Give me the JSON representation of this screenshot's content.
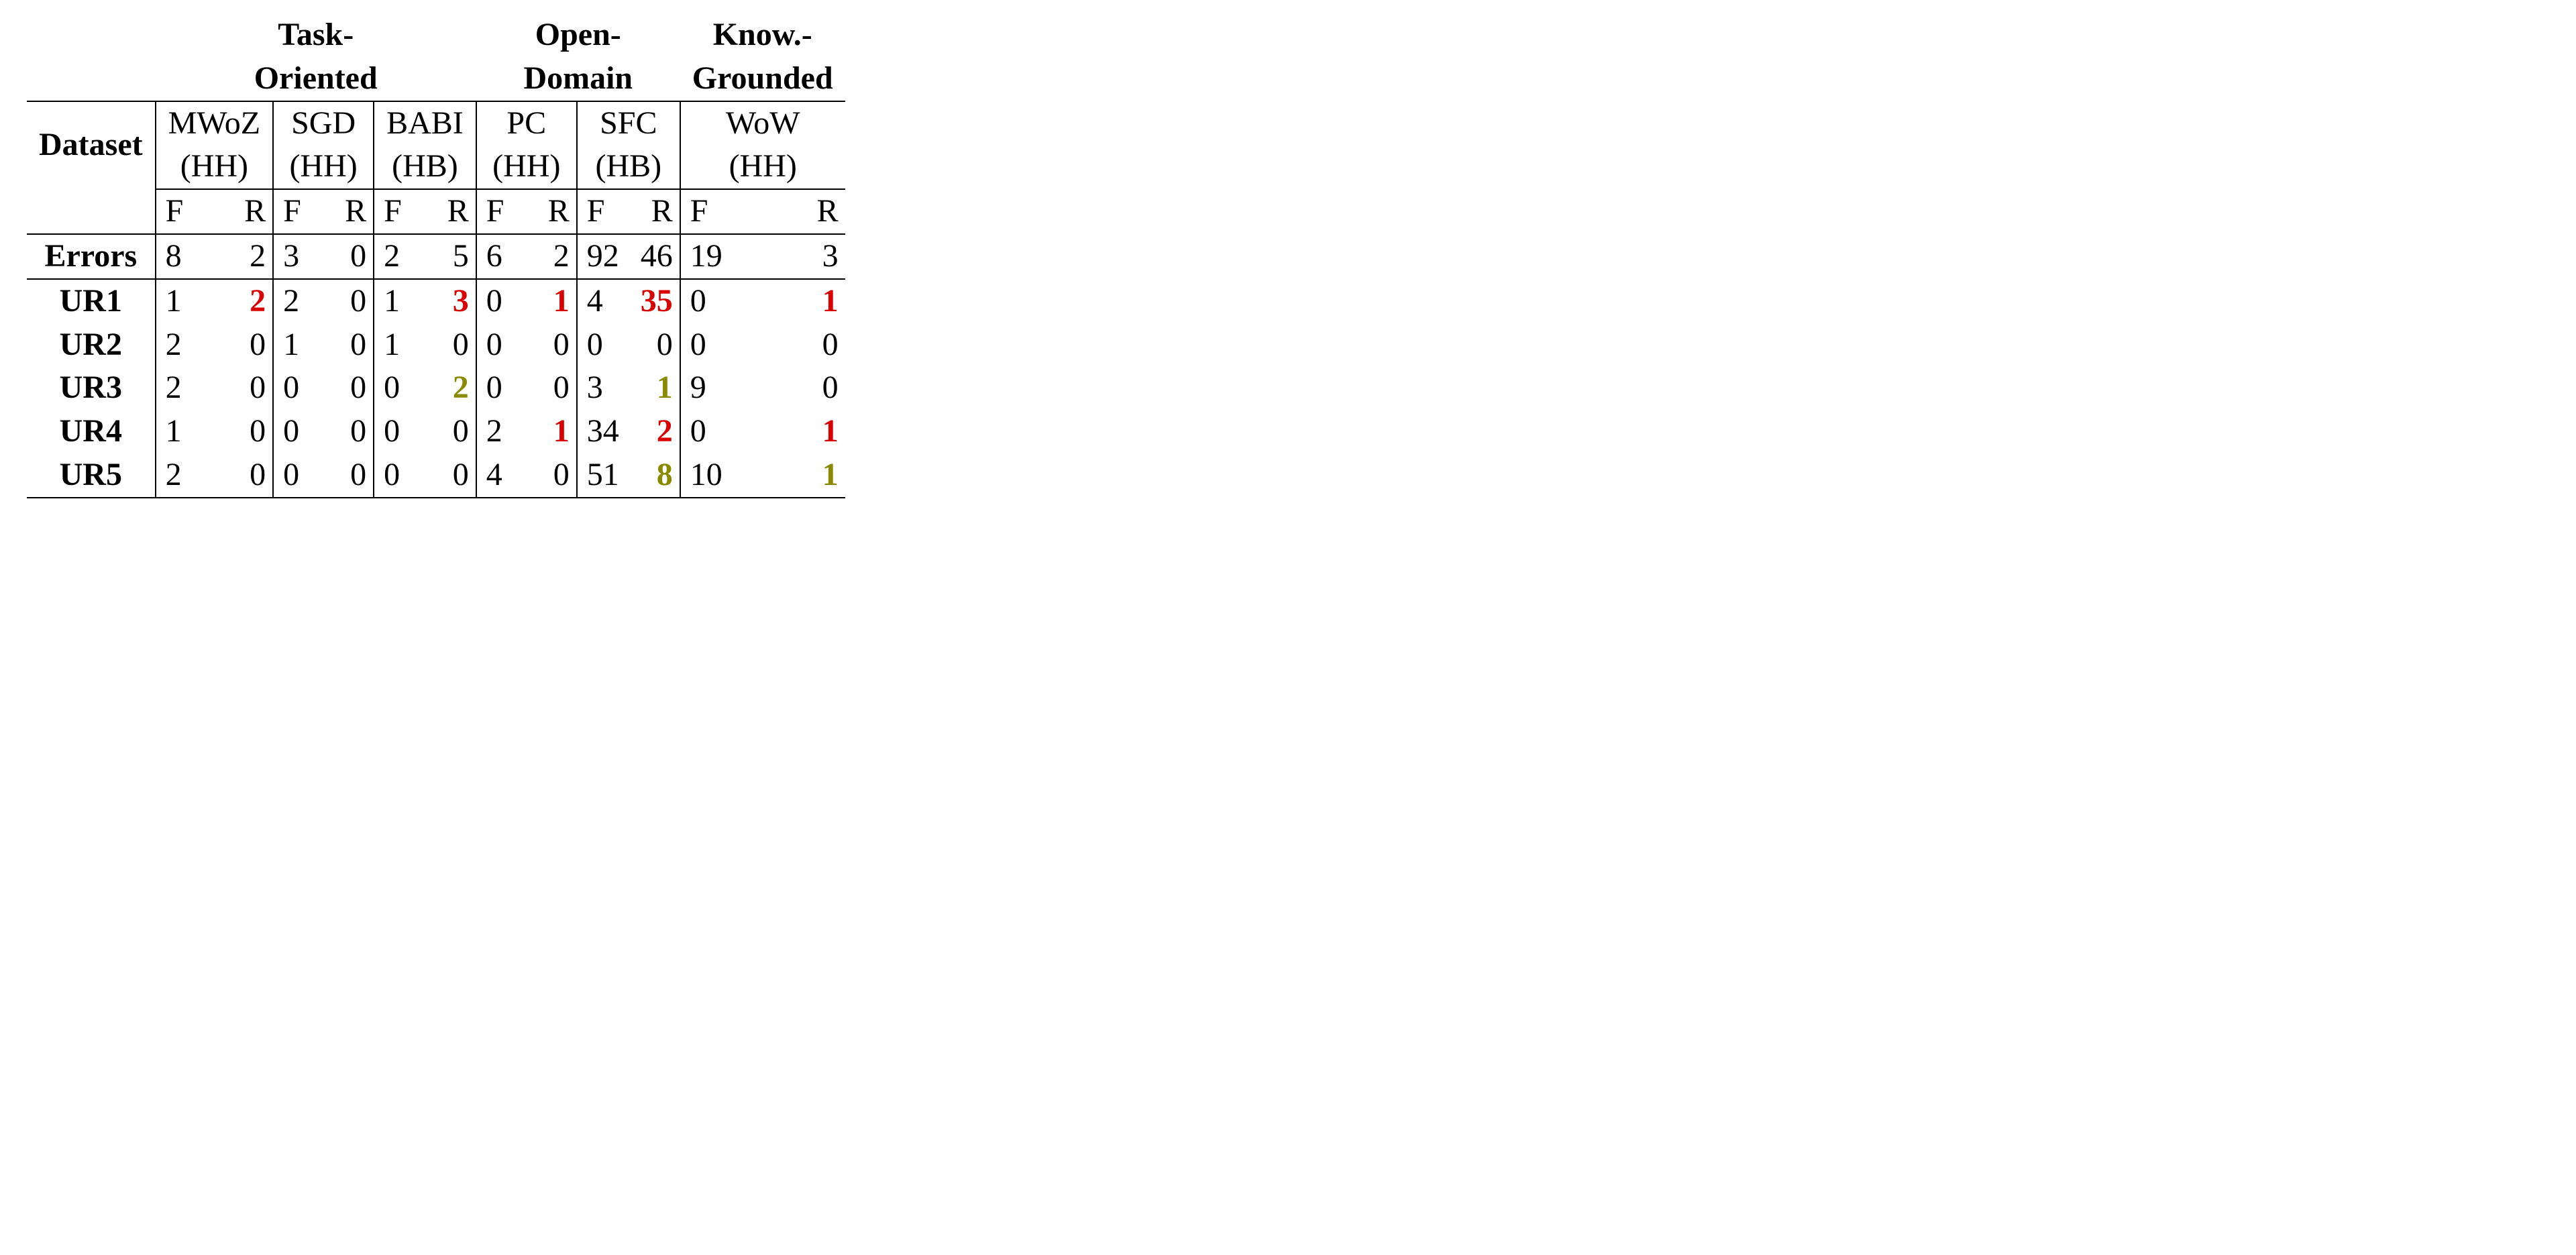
{
  "chart_data": {
    "type": "table",
    "groups": [
      {
        "name": "Task-Oriented",
        "datasets": [
          "MWoZ (HH)",
          "SGD (HH)",
          "BABI (HB)"
        ]
      },
      {
        "name": "Open-Domain",
        "datasets": [
          "PC (HH)",
          "SFC (HB)"
        ]
      },
      {
        "name": "Know.-Grounded",
        "datasets": [
          "WoW (HH)"
        ]
      }
    ],
    "subcolumns": [
      "F",
      "R"
    ],
    "rows": [
      {
        "label": "Errors",
        "values": [
          [
            8,
            2
          ],
          [
            3,
            0
          ],
          [
            2,
            5
          ],
          [
            6,
            2
          ],
          [
            92,
            46
          ],
          [
            19,
            3
          ]
        ]
      },
      {
        "label": "UR1",
        "values": [
          [
            1,
            2
          ],
          [
            2,
            0
          ],
          [
            1,
            3
          ],
          [
            0,
            1
          ],
          [
            4,
            35
          ],
          [
            0,
            1
          ]
        ]
      },
      {
        "label": "UR2",
        "values": [
          [
            2,
            0
          ],
          [
            1,
            0
          ],
          [
            1,
            0
          ],
          [
            0,
            0
          ],
          [
            0,
            0
          ],
          [
            0,
            0
          ]
        ]
      },
      {
        "label": "UR3",
        "values": [
          [
            2,
            0
          ],
          [
            0,
            0
          ],
          [
            0,
            2
          ],
          [
            0,
            0
          ],
          [
            3,
            1
          ],
          [
            9,
            0
          ]
        ]
      },
      {
        "label": "UR4",
        "values": [
          [
            1,
            0
          ],
          [
            0,
            0
          ],
          [
            0,
            0
          ],
          [
            2,
            1
          ],
          [
            34,
            2
          ],
          [
            0,
            1
          ]
        ]
      },
      {
        "label": "UR5",
        "values": [
          [
            2,
            0
          ],
          [
            0,
            0
          ],
          [
            0,
            0
          ],
          [
            4,
            0
          ],
          [
            51,
            8
          ],
          [
            10,
            1
          ]
        ]
      }
    ],
    "highlight": {
      "red": [
        [
          "UR1",
          0,
          "R"
        ],
        [
          "UR1",
          2,
          "R"
        ],
        [
          "UR1",
          3,
          "R"
        ],
        [
          "UR1",
          4,
          "R"
        ],
        [
          "UR1",
          5,
          "R"
        ],
        [
          "UR4",
          3,
          "R"
        ],
        [
          "UR4",
          4,
          "R"
        ],
        [
          "UR4",
          5,
          "R"
        ]
      ],
      "olive": [
        [
          "UR3",
          2,
          "R"
        ],
        [
          "UR3",
          4,
          "R"
        ],
        [
          "UR5",
          4,
          "R"
        ],
        [
          "UR5",
          5,
          "R"
        ]
      ]
    }
  },
  "hdr": {
    "grp0a": "Task-",
    "grp0b": "Oriented",
    "grp1a": "Open-",
    "grp1b": "Domain",
    "grp2a": "Know.-",
    "grp2b": "Grounded",
    "dataset": "Dataset",
    "d0a": "MWoZ",
    "d0b": "(HH)",
    "d1a": "SGD",
    "d1b": "(HH)",
    "d2a": "BABI",
    "d2b": "(HB)",
    "d3a": "PC",
    "d3b": "(HH)",
    "d4a": "SFC",
    "d4b": "(HB)",
    "d5a": "WoW",
    "d5b": "(HH)",
    "F": "F",
    "R": "R"
  },
  "rows": {
    "errors": {
      "label": "Errors",
      "c0F": "8",
      "c0R": "2",
      "c1F": "3",
      "c1R": "0",
      "c2F": "2",
      "c2R": "5",
      "c3F": "6",
      "c3R": "2",
      "c4F": "92",
      "c4R": "46",
      "c5F": "19",
      "c5R": "3"
    },
    "ur1": {
      "label": "UR1",
      "c0F": "1",
      "c0R": "2",
      "c1F": "2",
      "c1R": "0",
      "c2F": "1",
      "c2R": "3",
      "c3F": "0",
      "c3R": "1",
      "c4F": "4",
      "c4R": "35",
      "c5F": "0",
      "c5R": "1"
    },
    "ur2": {
      "label": "UR2",
      "c0F": "2",
      "c0R": "0",
      "c1F": "1",
      "c1R": "0",
      "c2F": "1",
      "c2R": "0",
      "c3F": "0",
      "c3R": "0",
      "c4F": "0",
      "c4R": "0",
      "c5F": "0",
      "c5R": "0"
    },
    "ur3": {
      "label": "UR3",
      "c0F": "2",
      "c0R": "0",
      "c1F": "0",
      "c1R": "0",
      "c2F": "0",
      "c2R": "2",
      "c3F": "0",
      "c3R": "0",
      "c4F": "3",
      "c4R": "1",
      "c5F": "9",
      "c5R": "0"
    },
    "ur4": {
      "label": "UR4",
      "c0F": "1",
      "c0R": "0",
      "c1F": "0",
      "c1R": "0",
      "c2F": "0",
      "c2R": "0",
      "c3F": "2",
      "c3R": "1",
      "c4F": "34",
      "c4R": "2",
      "c5F": "0",
      "c5R": "1"
    },
    "ur5": {
      "label": "UR5",
      "c0F": "2",
      "c0R": "0",
      "c1F": "0",
      "c1R": "0",
      "c2F": "0",
      "c2R": "0",
      "c3F": "4",
      "c3R": "0",
      "c4F": "51",
      "c4R": "8",
      "c5F": "10",
      "c5R": "1"
    }
  }
}
